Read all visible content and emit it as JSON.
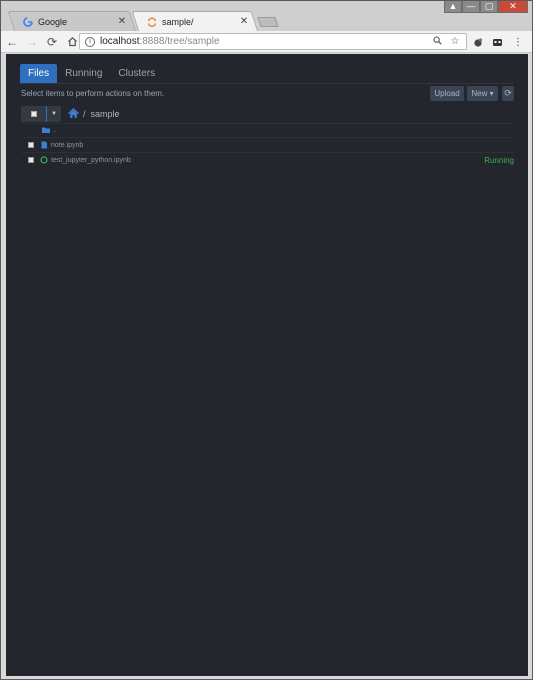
{
  "browser": {
    "tabs": [
      {
        "title": "Google",
        "active": false,
        "close": "✕"
      },
      {
        "title": "sample/",
        "active": true,
        "close": "✕"
      }
    ],
    "address": {
      "host": "localhost",
      "path": ":8888/tree/sample"
    },
    "window_controls": {
      "user": "▲",
      "min": "—",
      "max": "▢",
      "close": "✕"
    }
  },
  "jupyter": {
    "tabs": [
      {
        "label": "Files",
        "active": true
      },
      {
        "label": "Running",
        "active": false
      },
      {
        "label": "Clusters",
        "active": false
      }
    ],
    "hint": "Select items to perform actions on them.",
    "upload_label": "Upload",
    "new_label": "New ▾",
    "refresh_label": "⟳",
    "breadcrumb": {
      "sep": "/",
      "folder": "sample"
    },
    "items": [
      {
        "name": "..",
        "type": "folder",
        "status": ""
      },
      {
        "name": "note.ipynb",
        "type": "notebook",
        "status": ""
      },
      {
        "name": "test_jupyter_python.ipynb",
        "type": "notebook-running",
        "status": "Running"
      }
    ]
  },
  "colors": {
    "page_bg": "#23262d",
    "accent": "#2f6fc0",
    "running": "#3fae5b"
  }
}
